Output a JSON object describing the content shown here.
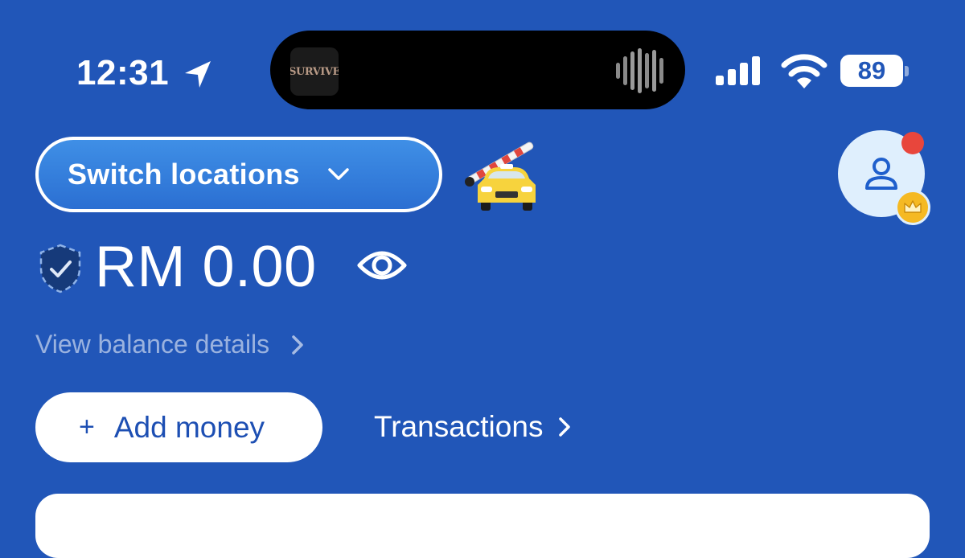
{
  "status_bar": {
    "time": "12:31",
    "now_playing_thumb": "SURVIVE",
    "battery": "89",
    "icons": [
      "location-arrow-icon",
      "waveform-icon",
      "signal-icon",
      "wifi-icon",
      "battery-icon"
    ]
  },
  "header": {
    "switch_label": "Switch locations",
    "switch_icon": "chevron-down-icon",
    "parking_icon": "car-barrier-icon",
    "avatar_icon": "user-icon",
    "badge_icon": "crown-icon"
  },
  "balance": {
    "amount": "RM 0.00",
    "shield_icon": "shield-check-icon",
    "visibility_icon": "eye-icon",
    "details_link": "View balance details"
  },
  "actions": {
    "add_plus": "+",
    "add_money": "Add money",
    "transactions": "Transactions"
  },
  "colors": {
    "background": "#2156b8",
    "notification_dot": "#e8463c",
    "crown_badge": "#f5b923",
    "avatar_bg": "#dfeffd"
  }
}
